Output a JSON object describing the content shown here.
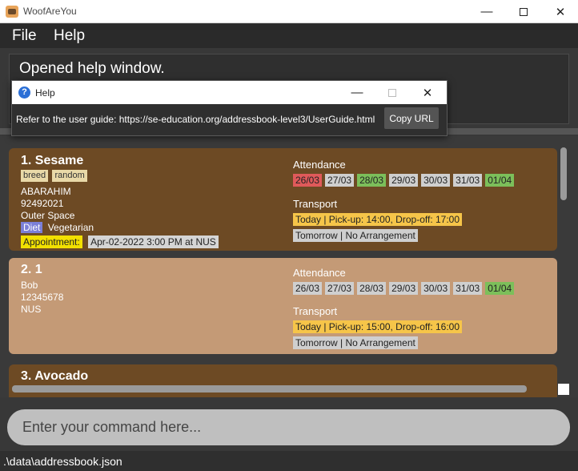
{
  "window": {
    "title": "WoofAreYou",
    "minimize_icon": "—",
    "close_icon": "✕"
  },
  "menu": {
    "file": "File",
    "help": "Help"
  },
  "result": {
    "text": "Opened help window."
  },
  "help_window": {
    "title": "Help",
    "icon_glyph": "?",
    "minimize_icon": "—",
    "close_icon": "✕",
    "message": "Refer to the user guide: https://se-education.org/addressbook-level3/UserGuide.html",
    "copy_button": "Copy URL"
  },
  "persons": [
    {
      "index": "1.",
      "name": "Sesame",
      "tags": [
        "breed",
        "random"
      ],
      "owner": "ABARAHIM",
      "phone": "92492021",
      "address": "Outer Space",
      "diet_label": "Diet",
      "diet": "Vegetarian",
      "appointment_label": "Appointment:",
      "appointment": "Apr-02-2022 3:00 PM at NUS",
      "attendance_title": "Attendance",
      "attendance": [
        {
          "date": "26/03",
          "status": "absent"
        },
        {
          "date": "27/03",
          "status": "none"
        },
        {
          "date": "28/03",
          "status": "present"
        },
        {
          "date": "29/03",
          "status": "none"
        },
        {
          "date": "30/03",
          "status": "none"
        },
        {
          "date": "31/03",
          "status": "none"
        },
        {
          "date": "01/04",
          "status": "present"
        }
      ],
      "transport_title": "Transport",
      "transport_today": "Today | Pick-up: 14:00, Drop-off: 17:00",
      "transport_tomorrow": "Tomorrow | No Arrangement"
    },
    {
      "index": "2.",
      "name": "1",
      "owner": "Bob",
      "phone": "12345678",
      "address": "NUS",
      "attendance_title": "Attendance",
      "attendance": [
        {
          "date": "26/03",
          "status": "none"
        },
        {
          "date": "27/03",
          "status": "none"
        },
        {
          "date": "28/03",
          "status": "none"
        },
        {
          "date": "29/03",
          "status": "none"
        },
        {
          "date": "30/03",
          "status": "none"
        },
        {
          "date": "31/03",
          "status": "none"
        },
        {
          "date": "01/04",
          "status": "present"
        }
      ],
      "transport_title": "Transport",
      "transport_today": "Today | Pick-up: 15:00, Drop-off: 16:00",
      "transport_tomorrow": "Tomorrow | No Arrangement"
    },
    {
      "index": "3.",
      "name": "Avocado"
    }
  ],
  "command": {
    "placeholder": "Enter your command here..."
  },
  "status_bar": {
    "path": ".\\data\\addressbook.json"
  },
  "colors": {
    "card_dark": "#6d4a24",
    "card_light": "#c49a76",
    "attendance_absent": "#e05a5a",
    "attendance_present": "#7cbf5a",
    "transport_today": "#f6c549",
    "appointment_label": "#f2e000",
    "diet_label": "#7b7fd8"
  }
}
